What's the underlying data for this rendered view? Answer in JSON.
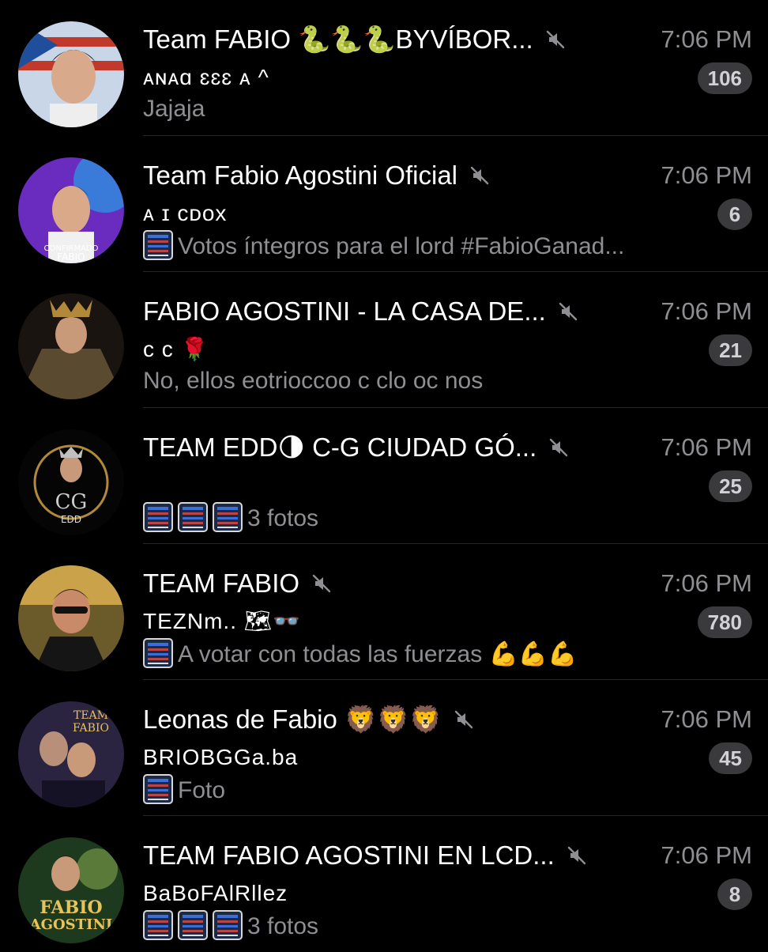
{
  "chats": [
    {
      "title": "Team FABIO 🐍🐍🐍BYVÍBOR...",
      "time": "7:06 PM",
      "sender": "ᴀɴᴀɑ ɛɛɛ ᴀ ^",
      "preview": "Jajaja",
      "badge": "106"
    },
    {
      "title": "Team Fabio Agostini Oficial",
      "time": "7:06 PM",
      "sender": "ᴀ ɪ ᴄᴅᴏx",
      "preview": "Votos íntegros para el lord #FabioGanad...",
      "badge": "6"
    },
    {
      "title": "FABIO AGOSTINI - LA CASA DE...",
      "time": "7:06 PM",
      "sender": "ᴄ ᴄ 🌹",
      "preview": "No, ellos eotrioccoo c clo oc nos",
      "badge": "21"
    },
    {
      "title": "TEAM EDD🌗 C-G CIUDAD GÓ...",
      "time": "7:06 PM",
      "sender": "",
      "preview": "3 fotos",
      "badge": "25"
    },
    {
      "title": "TEAM FABIO",
      "time": "7:06 PM",
      "sender": "TEZNm.. 🗺👓",
      "preview": "A votar con todas las fuerzas 💪💪💪",
      "badge": "780"
    },
    {
      "title": "Leonas de Fabio 🦁🦁🦁",
      "time": "7:06 PM",
      "sender": "BRIOBGGa.ba",
      "preview": "Foto",
      "badge": "45"
    },
    {
      "title": "TEAM FABIO AGOSTINI EN LCD...",
      "time": "7:06 PM",
      "sender": "BaBoFAlRllez",
      "preview": "3 fotos",
      "badge": "8"
    }
  ],
  "colors": {
    "background": "#000000",
    "secondary_text": "#8e8e93",
    "badge_bg": "#3a3a3c"
  },
  "icons": {
    "mute": "bell-slash-icon",
    "thumb": "photo-thumbnail"
  }
}
